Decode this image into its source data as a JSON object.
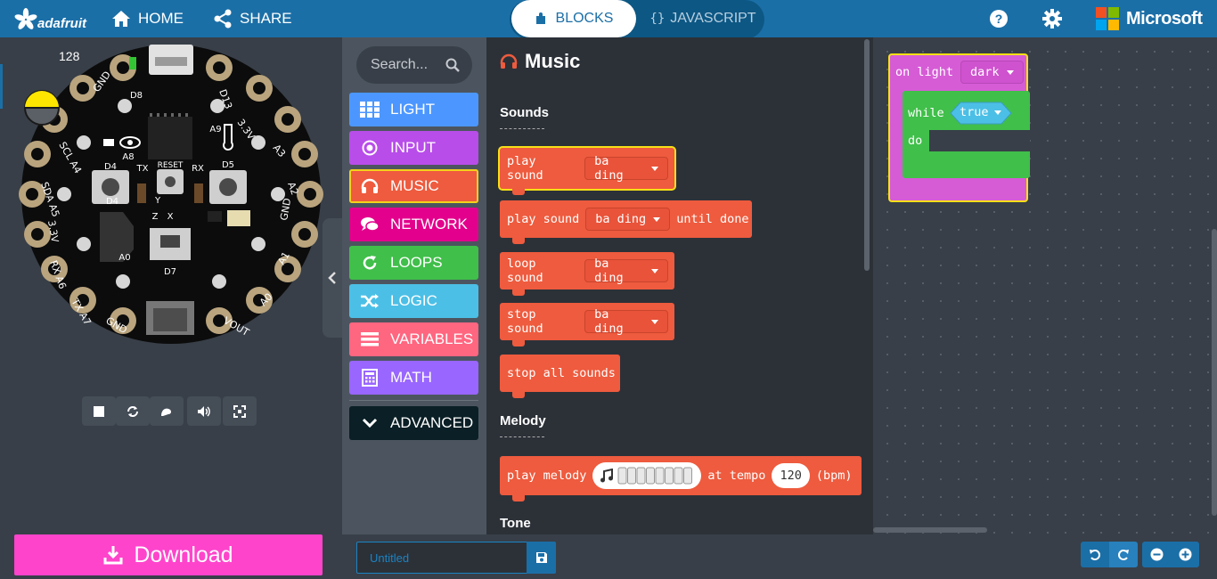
{
  "header": {
    "logo_text": "adafruit",
    "home_label": "HOME",
    "share_label": "SHARE",
    "tab_blocks_label": "BLOCKS",
    "tab_js_label": "JAVASCRIPT",
    "brand_label": "Microsoft",
    "icons": [
      "help-icon",
      "gear-icon"
    ]
  },
  "simulator": {
    "light_level": "128",
    "pin_labels": [
      "GND",
      "3.3V",
      "A3",
      "A2",
      "GND",
      "A1",
      "A0",
      "VOUT",
      "GND",
      "A7",
      "A6",
      "A5",
      "A4",
      "SCL",
      "SDA",
      "RX",
      "TX",
      "3.3V",
      "D13",
      "D8",
      "A8",
      "A9",
      "D4",
      "D5",
      "TX",
      "RX",
      "RESET",
      "A0",
      "D7",
      "Y",
      "Z",
      "X"
    ],
    "controls": [
      "stop-icon",
      "restart-icon",
      "slowmo-icon",
      "sound-icon",
      "fullscreen-icon"
    ]
  },
  "toolbox": {
    "search_placeholder": "Search...",
    "categories": [
      {
        "label": "LIGHT",
        "color": "#4c97ff",
        "icon": "grid-icon"
      },
      {
        "label": "INPUT",
        "color": "#b84de9",
        "icon": "radio-icon"
      },
      {
        "label": "MUSIC",
        "color": "#ee5b3e",
        "icon": "headphones-icon"
      },
      {
        "label": "NETWORK",
        "color": "#e3008c",
        "icon": "chat-icon"
      },
      {
        "label": "LOOPS",
        "color": "#40bf4a",
        "icon": "refresh-icon"
      },
      {
        "label": "LOGIC",
        "color": "#4cbfe6",
        "icon": "shuffle-icon"
      },
      {
        "label": "VARIABLES",
        "color": "#ff6680",
        "icon": "list-icon"
      },
      {
        "label": "MATH",
        "color": "#9966ff",
        "icon": "calculator-icon"
      },
      {
        "label": "ADVANCED",
        "color": "#0a1f26",
        "icon": "chevron-down-icon"
      }
    ]
  },
  "flyout": {
    "title": "Music",
    "section_sounds": "Sounds",
    "section_melody": "Melody",
    "section_tone": "Tone",
    "b1_text": "play sound",
    "b1_sound": "ba ding",
    "b2_text": "play sound",
    "b2_sound": "ba ding",
    "b2_suffix": "until done",
    "b3_text": "loop sound",
    "b3_sound": "ba ding",
    "b4_text": "stop sound",
    "b4_sound": "ba ding",
    "b5_text": "stop all sounds",
    "melody_prefix": "play melody",
    "melody_mid": "at tempo",
    "melody_tempo": "120",
    "melody_suffix": "(bpm)"
  },
  "workspace": {
    "event_text": "on light",
    "event_value": "dark",
    "while_text": "while",
    "while_value": "true",
    "do_text": "do"
  },
  "footer": {
    "download_label": "Download",
    "project_name_placeholder": "Untitled"
  },
  "colors": {
    "header": "#1b6fa7",
    "music": "#ee5b3e",
    "input_block": "#d65cd6",
    "loops_block": "#40bf4a",
    "download": "#ff44cc"
  }
}
